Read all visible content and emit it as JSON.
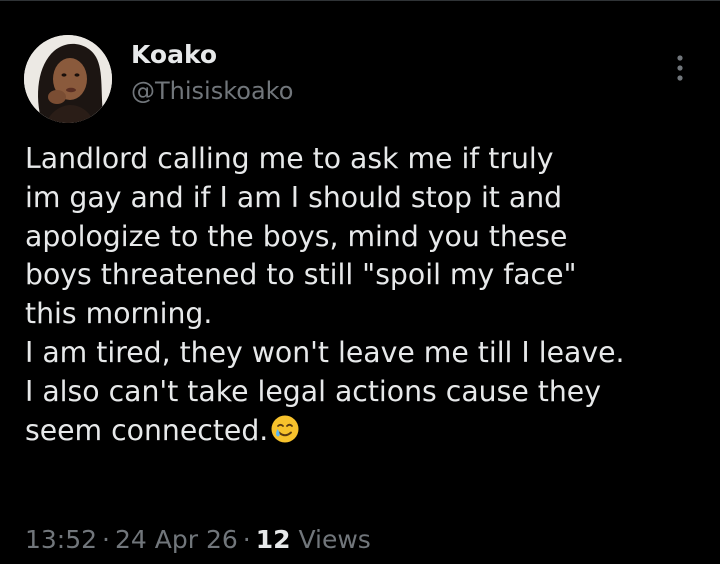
{
  "tweet": {
    "author": {
      "display_name": "Koako",
      "handle": "@Thisiskoako",
      "avatar_icon": "profile-photo"
    },
    "more_icon": "more-vertical-icon",
    "text": "Landlord calling me to ask me if truly\nim gay and if I am I should stop it and\napologize to the boys, mind you these\nboys threatened to still \"spoil my face\"\nthis morning.\nI am tired, they won't leave me till I leave.\nI also can't take legal actions cause they\nseem connected.",
    "emoji": "smiling-face-with-tear",
    "meta": {
      "time": "13:52",
      "separator": "·",
      "date": "24 Apr 26",
      "views_count": "12",
      "views_label": "Views"
    }
  },
  "colors": {
    "background": "#000000",
    "primary_text": "#e7e9ea",
    "secondary_text": "#71767b",
    "divider": "#2f3336"
  }
}
